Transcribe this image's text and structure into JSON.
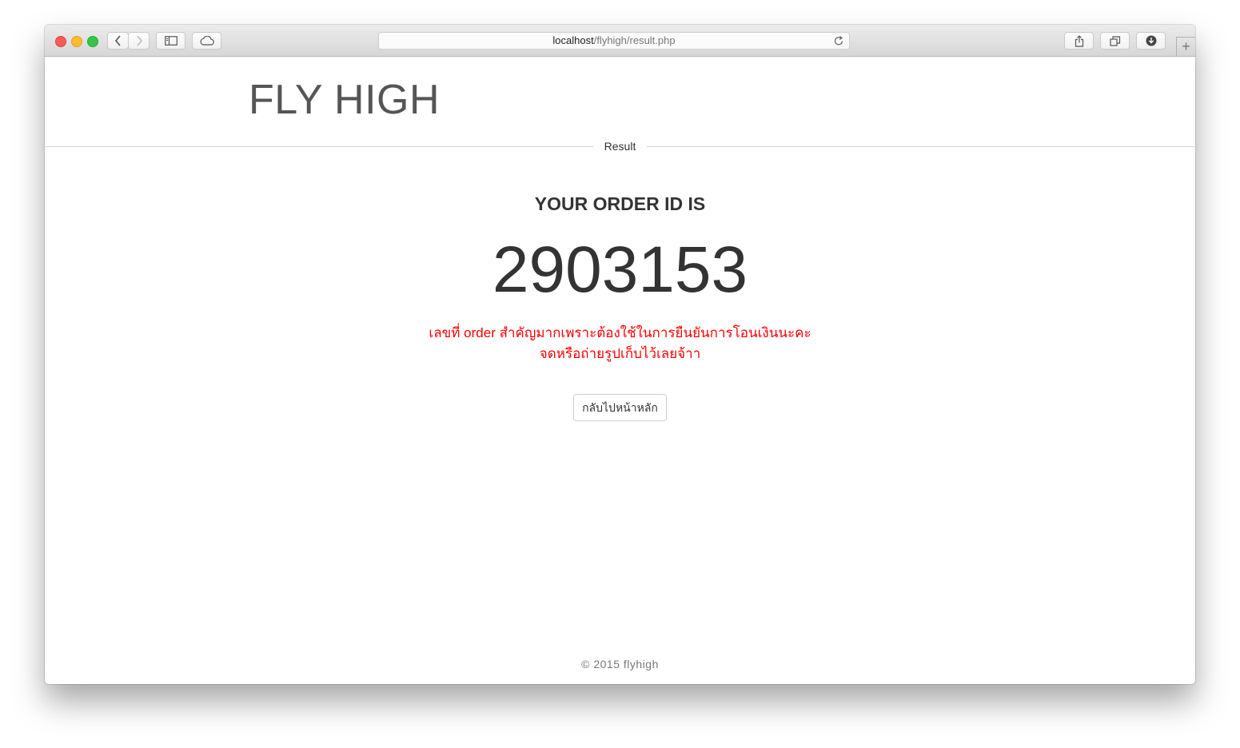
{
  "browser": {
    "url_host": "localhost",
    "url_path": "/flyhigh/result.php"
  },
  "header": {
    "brand": "FLY HIGH"
  },
  "section": {
    "label": "Result"
  },
  "order": {
    "heading": "YOUR ORDER ID IS",
    "id": "2903153",
    "notice_line1": "เลขที่ order สำคัญมากเพราะต้องใช้ในการยืนยันการโอนเงินนะคะ",
    "notice_line2": "จดหรือถ่ายรูปเก็บไว้เลยจ้าา"
  },
  "actions": {
    "home_label": "กลับไปหน้าหลัก"
  },
  "footer": {
    "copyright": "©  2015  flyhigh"
  },
  "colors": {
    "notice": "#ff0000",
    "brand": "#555555",
    "text": "#333333"
  }
}
